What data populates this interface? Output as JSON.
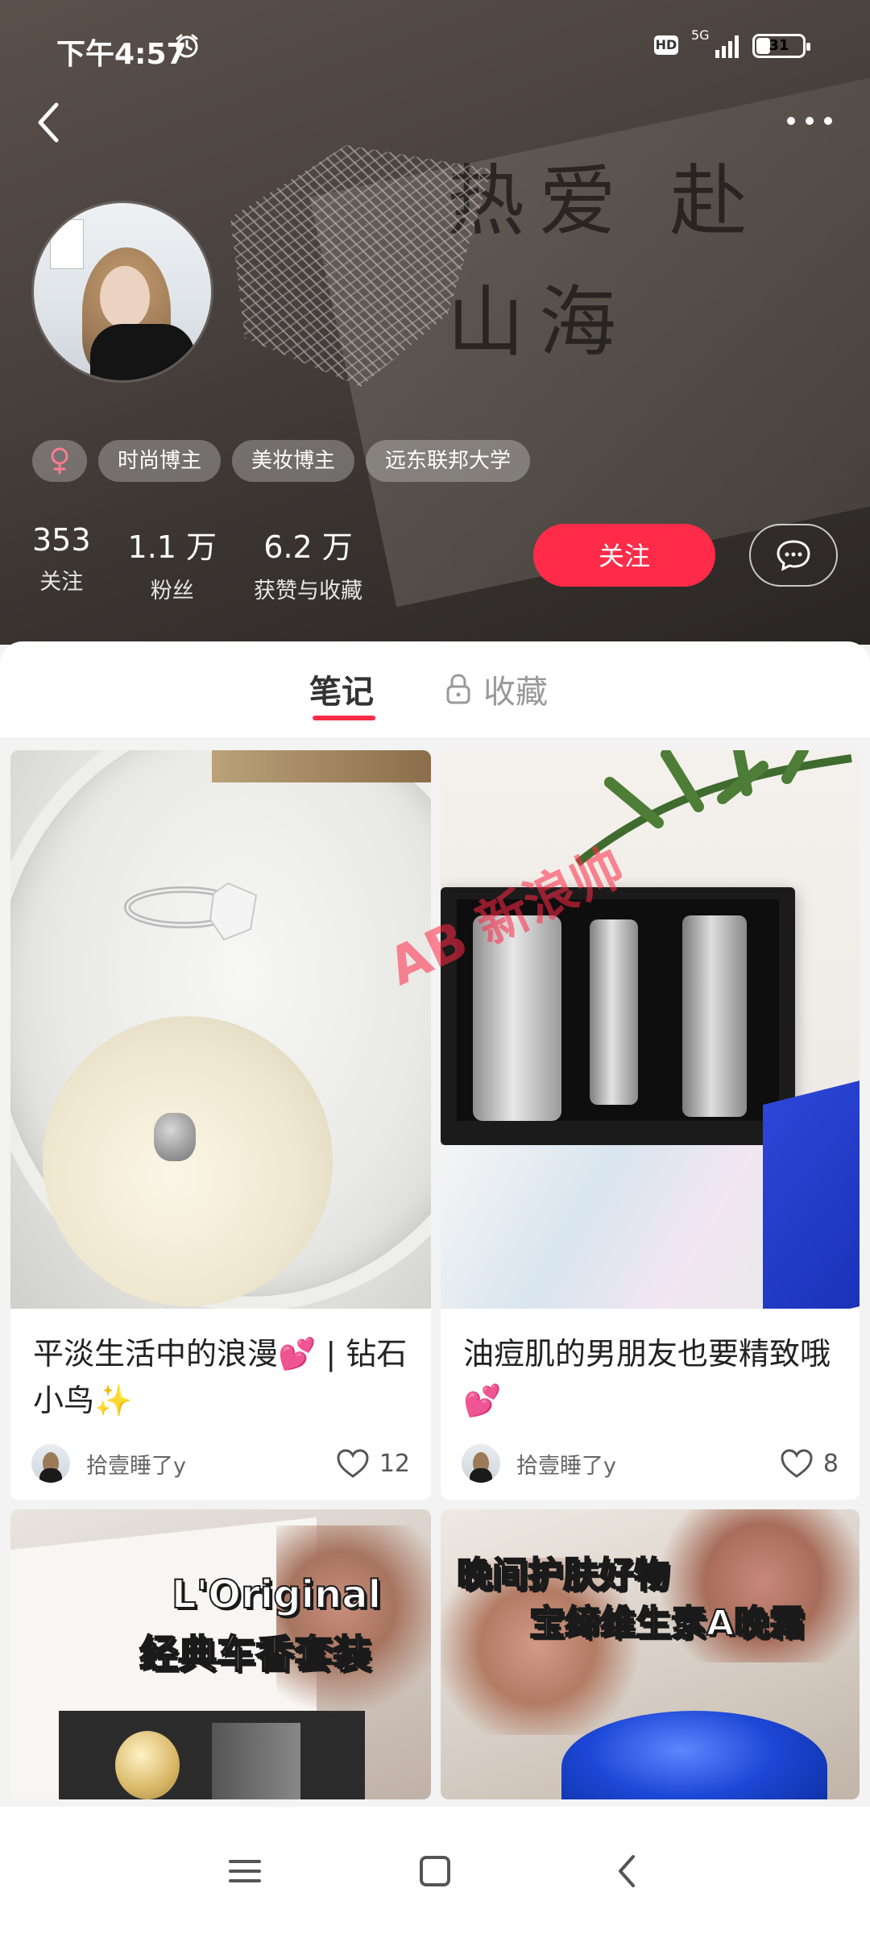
{
  "status_bar": {
    "time": "下午4:57",
    "hd": "HD",
    "network": "5G",
    "battery": "31",
    "battery_level": 0.31
  },
  "profile": {
    "tags": [
      "时尚博主",
      "美妆博主",
      "远东联邦大学"
    ],
    "stats": [
      {
        "value": "353",
        "label": "关注"
      },
      {
        "value": "1.1 万",
        "label": "粉丝"
      },
      {
        "value": "6.2 万",
        "label": "获赞与收藏"
      }
    ],
    "follow_label": "关注",
    "background_handwriting": "热爱 赴山海"
  },
  "tabs": {
    "notes": "笔记",
    "favorites": "收藏"
  },
  "notes": [
    {
      "title": "平淡生活中的浪漫💕 | 钻石小鸟✨",
      "author": "拾壹睡了y",
      "likes": "12"
    },
    {
      "title": "油痘肌的男朋友也要精致哦💕",
      "author": "拾壹睡了y",
      "likes": "8"
    },
    {
      "overlay_line1": "L'Original",
      "overlay_line2": "经典车香套装"
    },
    {
      "overlay_line1": "晚间护肤好物",
      "overlay_line2": "宝缔维生素A晚霜"
    }
  ],
  "watermark": "AB 新浪帅",
  "colors": {
    "accent": "#ff2b49"
  }
}
